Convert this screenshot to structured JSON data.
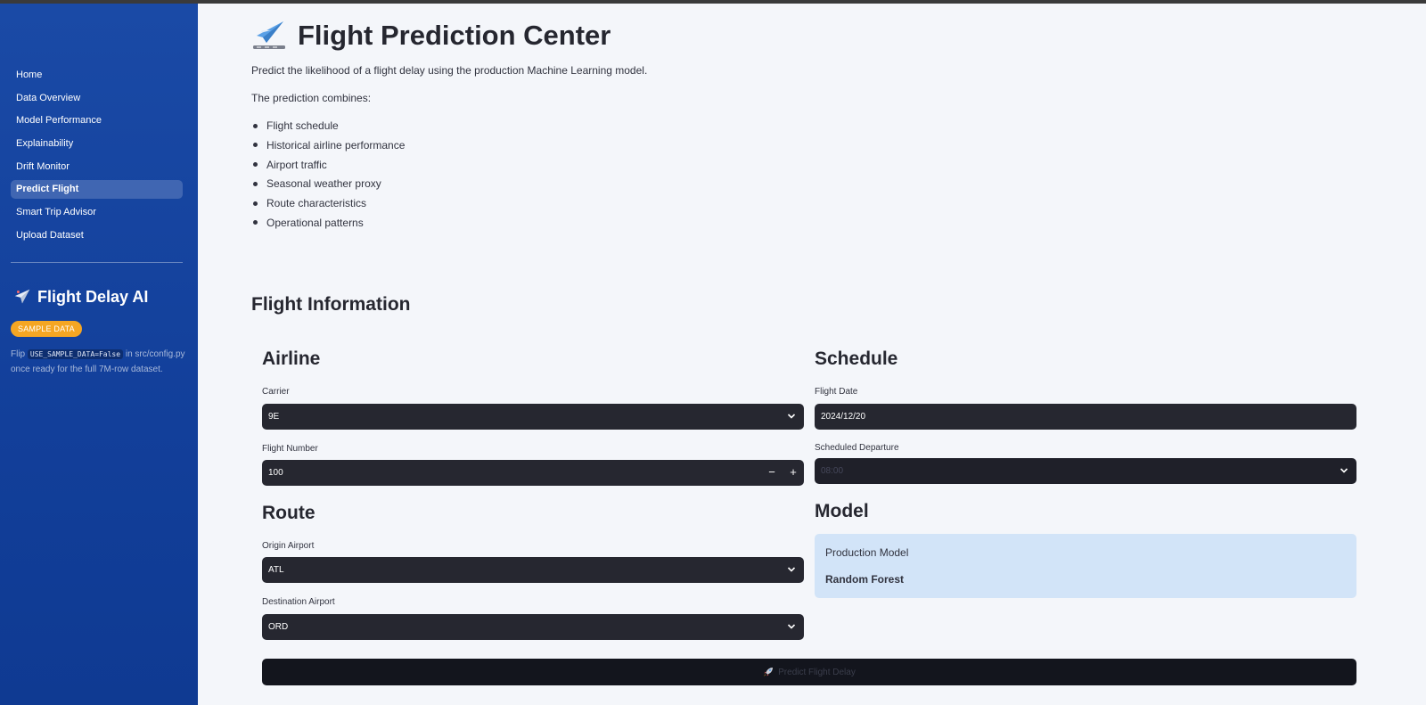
{
  "sidebar": {
    "nav": [
      {
        "label": "Home"
      },
      {
        "label": "Data Overview"
      },
      {
        "label": "Model Performance"
      },
      {
        "label": "Explainability"
      },
      {
        "label": "Drift Monitor"
      },
      {
        "label": "Predict Flight",
        "active": true
      },
      {
        "label": "Smart Trip Advisor"
      },
      {
        "label": "Upload Dataset"
      }
    ],
    "brand_title": "Flight Delay AI",
    "badge": "SAMPLE DATA",
    "note_before": "Flip ",
    "note_code": "USE_SAMPLE_DATA=False",
    "note_after": " in src/config.py once ready for the full 7M-row dataset."
  },
  "main": {
    "title": "Flight Prediction Center",
    "intro": "Predict the likelihood of a flight delay using the production Machine Learning model.",
    "combines_label": "The prediction combines:",
    "combines": [
      "Flight schedule",
      "Historical airline performance",
      "Airport traffic",
      "Seasonal weather proxy",
      "Route characteristics",
      "Operational patterns"
    ],
    "section_title": "Flight Information"
  },
  "airline": {
    "title": "Airline",
    "carrier_label": "Carrier",
    "carrier_value": "9E",
    "flight_number_label": "Flight Number",
    "flight_number_value": "100",
    "minus": "−",
    "plus": "+"
  },
  "schedule": {
    "title": "Schedule",
    "date_label": "Flight Date",
    "date_value": "2024/12/20",
    "departure_label": "Scheduled Departure",
    "departure_value": "08:00"
  },
  "route": {
    "title": "Route",
    "origin_label": "Origin Airport",
    "origin_value": "ATL",
    "destination_label": "Destination Airport",
    "destination_value": "ORD"
  },
  "model": {
    "title": "Model",
    "label": "Production Model",
    "value": "Random Forest"
  },
  "predict_button": "Predict Flight Delay",
  "colors": {
    "sidebar": "#1a4aa6",
    "badge": "#f5a623",
    "input_bg": "#262730",
    "model_card": "#d2e4f8"
  }
}
